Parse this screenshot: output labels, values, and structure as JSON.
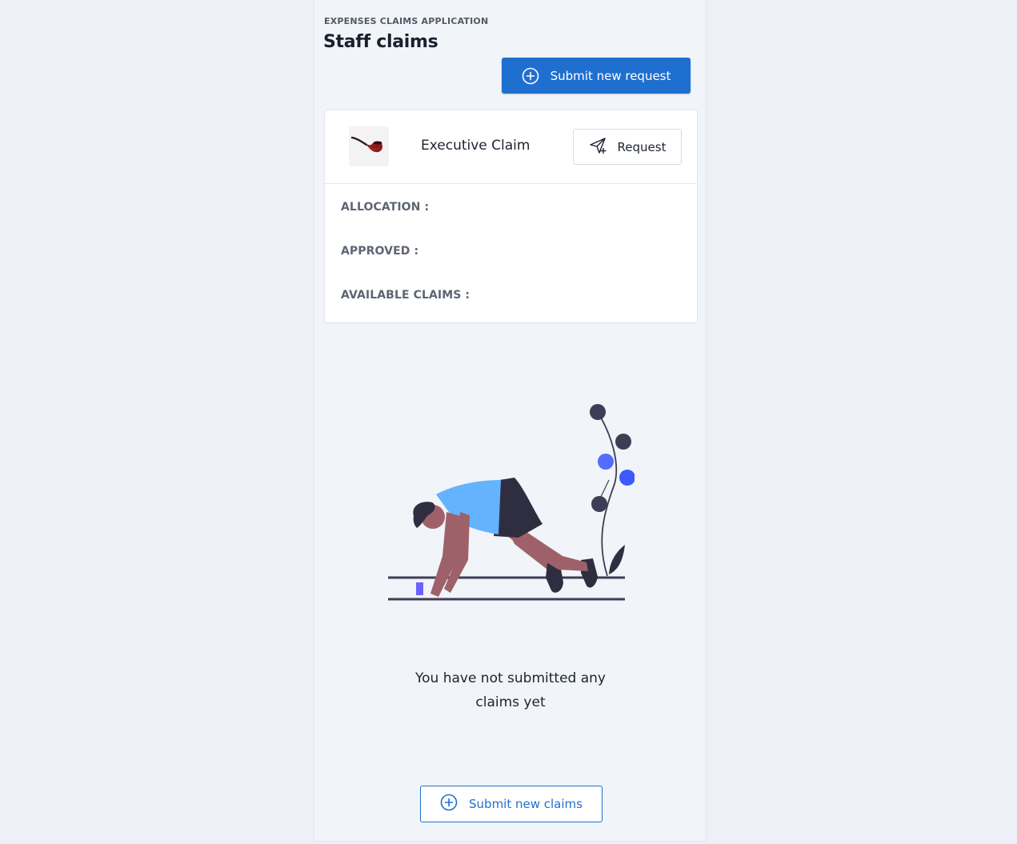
{
  "header": {
    "app_label": "EXPENSES CLAIMS APPLICATION",
    "title": "Staff claims",
    "submit_request_label": "Submit new request"
  },
  "claim_card": {
    "name": "Executive Claim",
    "request_label": "Request",
    "thumbnail_icon": "pipe-icon",
    "stats": {
      "allocation_label": "ALLOCATION :",
      "approved_label": "APPROVED :",
      "available_label": "AVAILABLE CLAIMS :"
    }
  },
  "empty_state": {
    "illustration_icon": "empty-state-illustration",
    "message": "You have not submitted any claims yet",
    "submit_claims_label": "Submit new claims"
  },
  "colors": {
    "background": "#edf1f7",
    "panel": "#f1f4f8",
    "accent": "#1f6fd0",
    "text": "#1c2330",
    "muted_label": "#5e6573"
  }
}
